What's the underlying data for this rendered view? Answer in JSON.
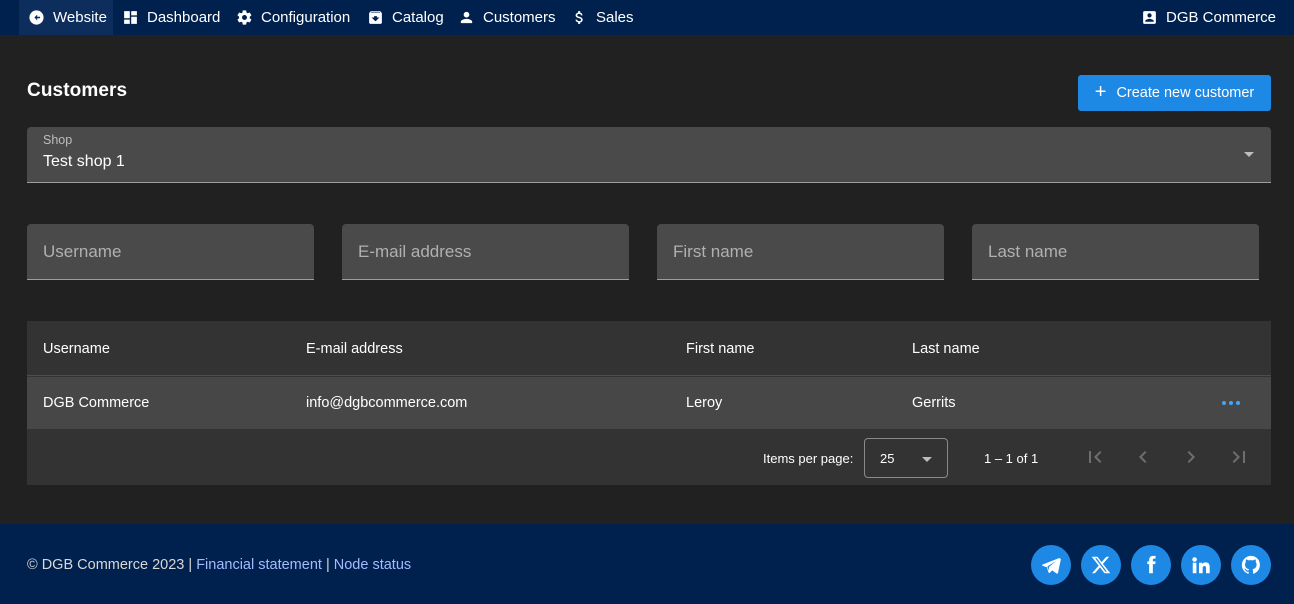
{
  "nav": {
    "items": [
      {
        "label": "Website",
        "icon": "back-circle-icon"
      },
      {
        "label": "Dashboard",
        "icon": "dashboard-icon"
      },
      {
        "label": "Configuration",
        "icon": "gear-icon"
      },
      {
        "label": "Catalog",
        "icon": "archive-icon"
      },
      {
        "label": "Customers",
        "icon": "person-icon"
      },
      {
        "label": "Sales",
        "icon": "dollar-icon"
      }
    ],
    "account": {
      "label": "DGB Commerce",
      "icon": "account-box-icon"
    }
  },
  "page": {
    "title": "Customers",
    "create_button": "Create new customer"
  },
  "shop_select": {
    "label": "Shop",
    "value": "Test shop 1"
  },
  "filters": {
    "username": "Username",
    "email": "E-mail address",
    "first_name": "First name",
    "last_name": "Last name"
  },
  "table": {
    "headers": [
      "Username",
      "E-mail address",
      "First name",
      "Last name"
    ],
    "rows": [
      [
        "DGB Commerce",
        "info@dgbcommerce.com",
        "Leroy",
        "Gerrits"
      ]
    ]
  },
  "paginator": {
    "items_per_page_label": "Items per page:",
    "items_per_page_value": "25",
    "range": "1 – 1 of 1"
  },
  "footer": {
    "copyright": "© DGB Commerce 2023 |",
    "separator": "|",
    "link_financial": "Financial statement",
    "link_node": "Node status",
    "social": [
      "telegram-icon",
      "x-icon",
      "facebook-icon",
      "linkedin-icon",
      "github-icon"
    ]
  },
  "colors": {
    "nav_bg": "#00204d",
    "page_bg": "#212121",
    "accent": "#1e88e5",
    "footer_link": "#a5b9ff"
  }
}
